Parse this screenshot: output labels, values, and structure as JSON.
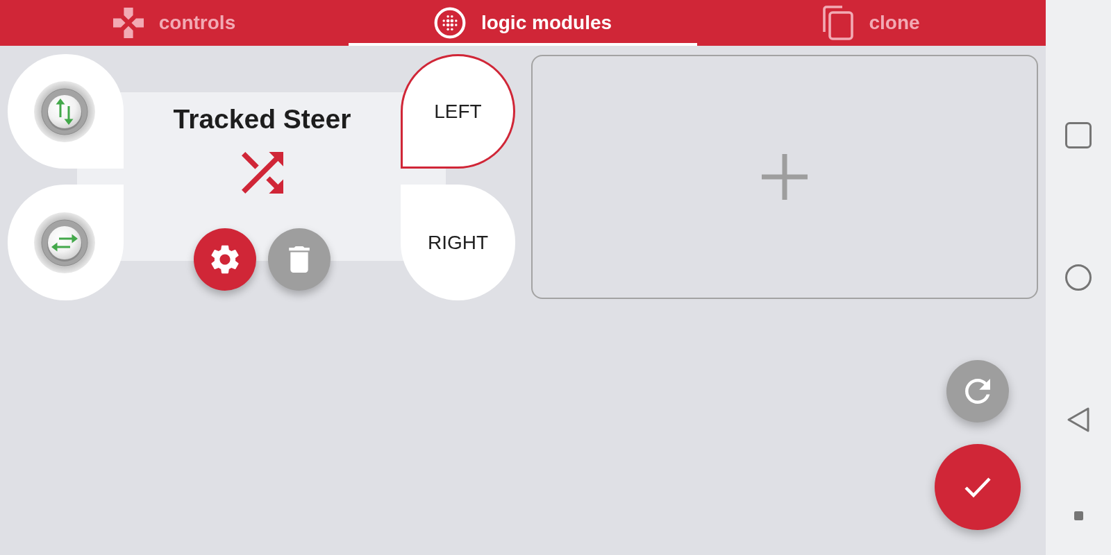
{
  "tabs": [
    {
      "label": "controls",
      "selected": false
    },
    {
      "label": "logic modules",
      "selected": true
    },
    {
      "label": "clone",
      "selected": false
    }
  ],
  "module": {
    "title": "Tracked Steer",
    "outputs": [
      {
        "label": "LEFT",
        "selected": true
      },
      {
        "label": "RIGHT",
        "selected": false
      }
    ]
  }
}
